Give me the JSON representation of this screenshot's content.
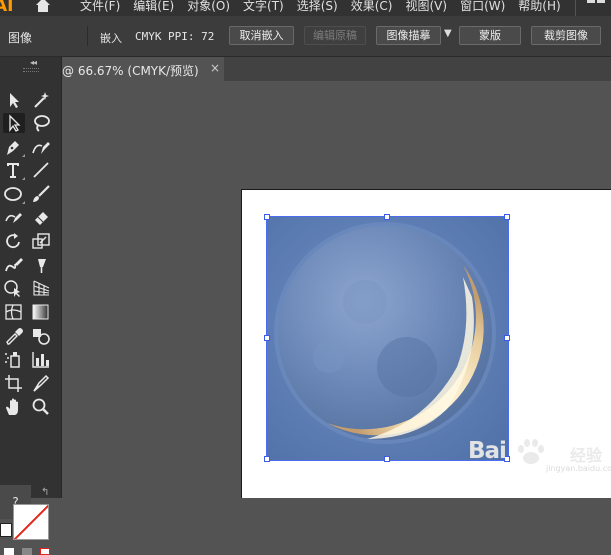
{
  "app": {
    "logo": "AI",
    "menus": [
      "文件(F)",
      "编辑(E)",
      "对象(O)",
      "文字(T)",
      "选择(S)",
      "效果(C)",
      "视图(V)",
      "窗口(W)",
      "帮助(H)"
    ]
  },
  "control_bar": {
    "context_label": "图像",
    "embed_label": "嵌入",
    "color_mode": "CMYK",
    "ppi": "PPI: 72",
    "unembed_button": "取消嵌入",
    "edit_original_button": "编辑原稿",
    "image_trace_button": "图像描摹",
    "mask_button": "蒙版",
    "crop_image_button": "裁剪图像"
  },
  "document_tab": {
    "title": "@ 66.67% (CMYK/预览)",
    "close": "×"
  },
  "tool_panel": {
    "collapse_glyph": "◂◂",
    "help_tip": "?",
    "swap_glyph": "↰",
    "tools": [
      "selection-tool",
      "magic-wand-tool",
      "direct-selection-tool",
      "lasso-tool",
      "pen-tool",
      "curvature-tool",
      "type-tool",
      "line-segment-tool",
      "ellipse-tool",
      "paintbrush-tool",
      "shaper-tool",
      "eraser-tool",
      "rotate-tool",
      "scale-tool",
      "warp-tool",
      "free-transform-tool",
      "shape-builder-tool",
      "perspective-grid-tool",
      "mesh-tool",
      "gradient-tool",
      "eyedropper-tool",
      "blend-tool",
      "symbol-sprayer-tool",
      "column-graph-tool",
      "artboard-tool",
      "slice-tool",
      "hand-tool",
      "zoom-tool"
    ],
    "stroke_color": "#ffffff",
    "stroke_slash_color": "#e0261b"
  },
  "canvas": {
    "background": "#535353",
    "artboard_color": "#ffffff",
    "selection_color": "#4c6cf0",
    "image_subject": "crescent-moon-photo",
    "image_colors": {
      "sky": "#5b7bb0",
      "moon_dark": "#4d6a9c",
      "crescent": "#f5e6c4"
    }
  },
  "watermark": {
    "brand": "Bai",
    "brand_cn": "经验",
    "url": "jingyan.baidu.com"
  }
}
